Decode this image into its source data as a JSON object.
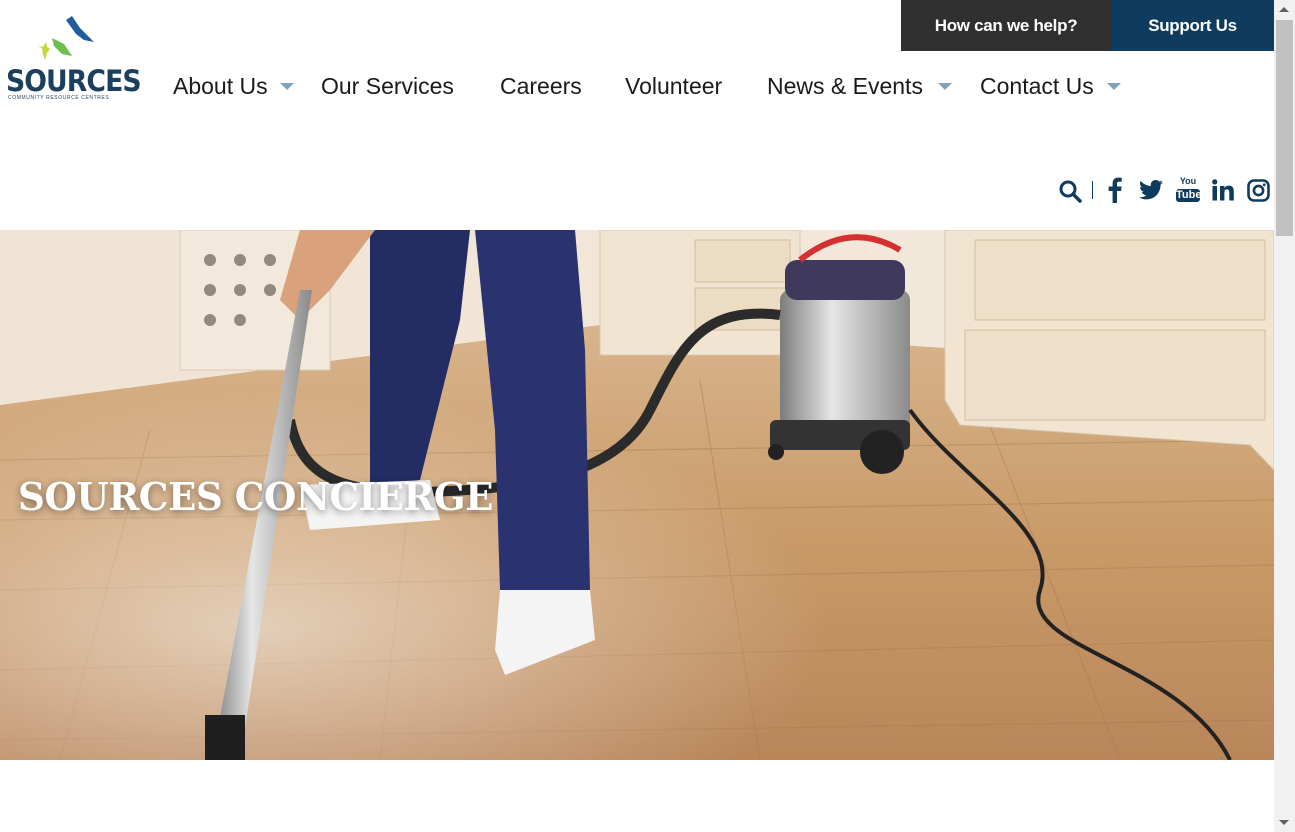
{
  "logo": {
    "name": "SOURCES",
    "tagline": "COMMUNITY RESOURCE CENTRES"
  },
  "topbar": {
    "help_label": "How can we help?",
    "support_label": "Support Us"
  },
  "nav": {
    "items": [
      {
        "label": "About Us",
        "has_dropdown": true
      },
      {
        "label": "Our Services",
        "has_dropdown": false
      },
      {
        "label": "Careers",
        "has_dropdown": false
      },
      {
        "label": "Volunteer",
        "has_dropdown": false
      },
      {
        "label": "News & Events",
        "has_dropdown": true
      },
      {
        "label": "Contact Us",
        "has_dropdown": true
      }
    ]
  },
  "social": {
    "icons": [
      "search-icon",
      "facebook-icon",
      "twitter-icon",
      "youtube-icon",
      "linkedin-icon",
      "instagram-icon"
    ],
    "youtube_text_top": "You",
    "youtube_text_bottom": "Tube"
  },
  "hero": {
    "title": "SOURCES CONCIERGE"
  },
  "colors": {
    "brand_navy": "#0e3b5e",
    "help_bg": "#303030",
    "caret": "#7fa1bd"
  }
}
